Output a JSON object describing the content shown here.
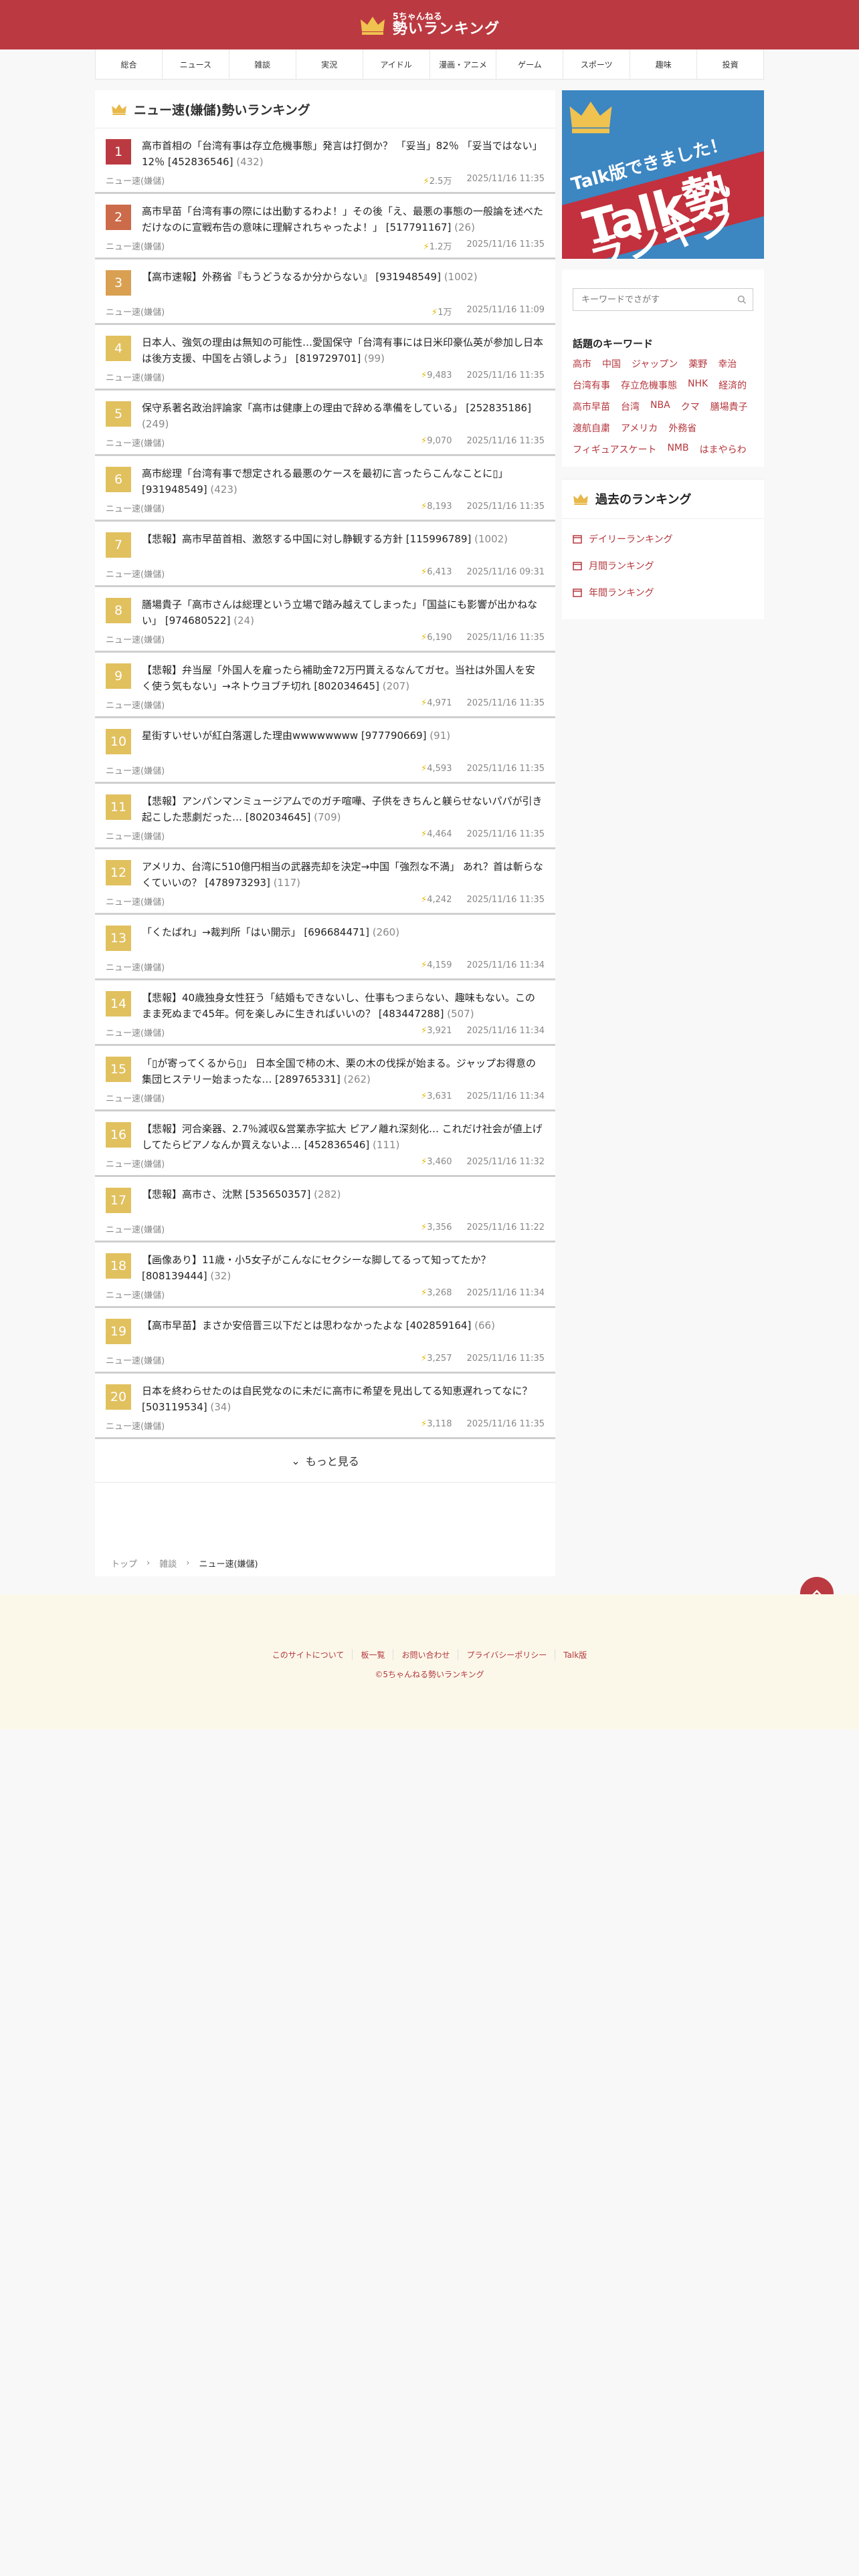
{
  "header": {
    "logo_sub": "5ちゃんねる",
    "logo_main": "勢いランキング"
  },
  "nav": [
    "総合",
    "ニュース",
    "雑談",
    "実況",
    "アイドル",
    "漫画・アニメ",
    "ゲーム",
    "スポーツ",
    "趣味",
    "投資"
  ],
  "main": {
    "title": "ニュー速(嫌儲)勢いランキング",
    "more_label": "もっと見る",
    "items": [
      {
        "rank": "1",
        "title": "高市首相の「台湾有事は存立危機事態」発言は打倒か？ 「妥当」82％ 「妥当ではない」12％ [452836546]",
        "count": "(432)",
        "board": "ニュー速(嫌儲)",
        "momentum": "2.5万",
        "time": "2025/11/16 11:35",
        "color": "#bb3a41"
      },
      {
        "rank": "2",
        "title": "高市早苗「台湾有事の際には出動するわよ！」その後「え、最悪の事態の一般論を述べただけなのに宣戦布告の意味に理解されちゃったよ！」 [517791167]",
        "count": "(26)",
        "board": "ニュー速(嫌儲)",
        "momentum": "1.2万",
        "time": "2025/11/16 11:35",
        "color": "#cc6b49"
      },
      {
        "rank": "3",
        "title": "【高市速報】外務省『もうどうなるか分からない』 [931948549]",
        "count": "(1002)",
        "board": "ニュー速(嫌儲)",
        "momentum": "1万",
        "time": "2025/11/16 11:09",
        "color": "#d9a052"
      },
      {
        "rank": "4",
        "title": "日本人、強気の理由は無知の可能性…愛国保守「台湾有事には日米印豪仏英が参加し日本は後方支援、中国を占領しよう」 [819729701]",
        "count": "(99)",
        "board": "ニュー速(嫌儲)",
        "momentum": "9,483",
        "time": "2025/11/16 11:35",
        "color": "#e1c05e"
      },
      {
        "rank": "5",
        "title": "保守系著名政治評論家「高市は健康上の理由で辞める準備をしている」 [252835186]",
        "count": "(249)",
        "board": "ニュー速(嫌儲)",
        "momentum": "9,070",
        "time": "2025/11/16 11:35",
        "color": "#e1c05e"
      },
      {
        "rank": "6",
        "title": "高市総理「台湾有事で想定される最悪のケースを最初に言ったらこんなことに▯」 [931948549]",
        "count": "(423)",
        "board": "ニュー速(嫌儲)",
        "momentum": "8,193",
        "time": "2025/11/16 11:35",
        "color": "#e1c05e"
      },
      {
        "rank": "7",
        "title": "【悲報】高市早苗首相、激怒する中国に対し静観する方針 [115996789]",
        "count": "(1002)",
        "board": "ニュー速(嫌儲)",
        "momentum": "6,413",
        "time": "2025/11/16 09:31",
        "color": "#e1c05e"
      },
      {
        "rank": "8",
        "title": "膳場貴子「高市さんは総理という立場で踏み越えてしまった」「国益にも影響が出かねない」 [974680522]",
        "count": "(24)",
        "board": "ニュー速(嫌儲)",
        "momentum": "6,190",
        "time": "2025/11/16 11:35",
        "color": "#e1c05e"
      },
      {
        "rank": "9",
        "title": "【悲報】弁当屋「外国人を雇ったら補助金72万円貰えるなんてガセ。当社は外国人を安く使う気もない」→ネトウヨブチ切れ [802034645]",
        "count": "(207)",
        "board": "ニュー速(嫌儲)",
        "momentum": "4,971",
        "time": "2025/11/16 11:35",
        "color": "#e1c05e"
      },
      {
        "rank": "10",
        "title": "星街すいせいが紅白落選した理由wwwwwwww [977790669]",
        "count": "(91)",
        "board": "ニュー速(嫌儲)",
        "momentum": "4,593",
        "time": "2025/11/16 11:35",
        "color": "#e1c05e"
      },
      {
        "rank": "11",
        "title": "【悲報】アンパンマンミュージアムでのガチ喧嘩、子供をきちんと躾らせないパパが引き起こした悲劇だった… [802034645]",
        "count": "(709)",
        "board": "ニュー速(嫌儲)",
        "momentum": "4,464",
        "time": "2025/11/16 11:35",
        "color": "#e1c05e"
      },
      {
        "rank": "12",
        "title": "アメリカ、台湾に510億円相当の武器売却を決定→中国「強烈な不満」 あれ？首は斬らなくていいの？ [478973293]",
        "count": "(117)",
        "board": "ニュー速(嫌儲)",
        "momentum": "4,242",
        "time": "2025/11/16 11:35",
        "color": "#e1c05e"
      },
      {
        "rank": "13",
        "title": "「くたばれ」→裁判所「はい開示」 [696684471]",
        "count": "(260)",
        "board": "ニュー速(嫌儲)",
        "momentum": "4,159",
        "time": "2025/11/16 11:34",
        "color": "#e1c05e"
      },
      {
        "rank": "14",
        "title": "【悲報】40歳独身女性狂う「結婚もできないし、仕事もつまらない、趣味もない。このまま死ぬまで45年。何を楽しみに生きればいいの？ [483447288]",
        "count": "(507)",
        "board": "ニュー速(嫌儲)",
        "momentum": "3,921",
        "time": "2025/11/16 11:34",
        "color": "#e1c05e"
      },
      {
        "rank": "15",
        "title": "「▯が寄ってくるから▯」 日本全国で柿の木、栗の木の伐採が始まる。ジャップお得意の集団ヒステリー始まったな… [289765331]",
        "count": "(262)",
        "board": "ニュー速(嫌儲)",
        "momentum": "3,631",
        "time": "2025/11/16 11:34",
        "color": "#e1c05e"
      },
      {
        "rank": "16",
        "title": "【悲報】河合楽器、2.7％減収&営業赤字拡大 ピアノ離れ深刻化… これだけ社会が値上げしてたらピアノなんか買えないよ… [452836546]",
        "count": "(111)",
        "board": "ニュー速(嫌儲)",
        "momentum": "3,460",
        "time": "2025/11/16 11:32",
        "color": "#e1c05e"
      },
      {
        "rank": "17",
        "title": "【悲報】高市さ、沈黙 [535650357]",
        "count": "(282)",
        "board": "ニュー速(嫌儲)",
        "momentum": "3,356",
        "time": "2025/11/16 11:22",
        "color": "#e1c05e"
      },
      {
        "rank": "18",
        "title": "【画像あり】11歳・小5女子がこんなにセクシーな脚してるって知ってたか？ [808139444]",
        "count": "(32)",
        "board": "ニュー速(嫌儲)",
        "momentum": "3,268",
        "time": "2025/11/16 11:34",
        "color": "#e1c05e"
      },
      {
        "rank": "19",
        "title": "【高市早苗】まさか安倍晋三以下だとは思わなかったよな [402859164]",
        "count": "(66)",
        "board": "ニュー速(嫌儲)",
        "momentum": "3,257",
        "time": "2025/11/16 11:35",
        "color": "#e1c05e"
      },
      {
        "rank": "20",
        "title": "日本を終わらせたのは自民党なのに未だに高市に希望を見出してる知恵遅れってなに？ [503119534]",
        "count": "(34)",
        "board": "ニュー速(嫌儲)",
        "momentum": "3,118",
        "time": "2025/11/16 11:35",
        "color": "#e1c05e"
      }
    ]
  },
  "breadcrumb": {
    "home": "トップ",
    "category": "雑談",
    "current": "ニュー速(嫌儲)"
  },
  "sidebar": {
    "banner": {
      "line1": "Talk版できました！",
      "line2": "Talk勢い",
      "line3": "ランキング"
    },
    "search_placeholder": "キーワードでさがす",
    "keywords_title": "話題のキーワード",
    "keywords": [
      "高市",
      "中国",
      "ジャップン",
      "薬野",
      "幸治",
      "台湾有事",
      "存立危機事態",
      "NHK",
      "経済的",
      "高市早苗",
      "台湾",
      "NBA",
      "クマ",
      "膳場貴子",
      "渡航自粛",
      "アメリカ",
      "外務省",
      "フィギュアスケート",
      "NMB",
      "はまやらわ"
    ],
    "past_title": "過去のランキング",
    "past_items": [
      "デイリーランキング",
      "月間ランキング",
      "年間ランキング"
    ]
  },
  "footer": {
    "links": [
      "このサイトについて",
      "板一覧",
      "お問い合わせ",
      "プライバシーポリシー",
      "Talk版"
    ],
    "copyright": "©5ちゃんねる勢いランキング"
  },
  "colors": {
    "brand": "#bb3a41",
    "rank1": "#bb3a41",
    "rank2": "#cc6b49",
    "rank3": "#d9a052",
    "rank_other": "#e1c05e",
    "link": "#b5373d"
  }
}
